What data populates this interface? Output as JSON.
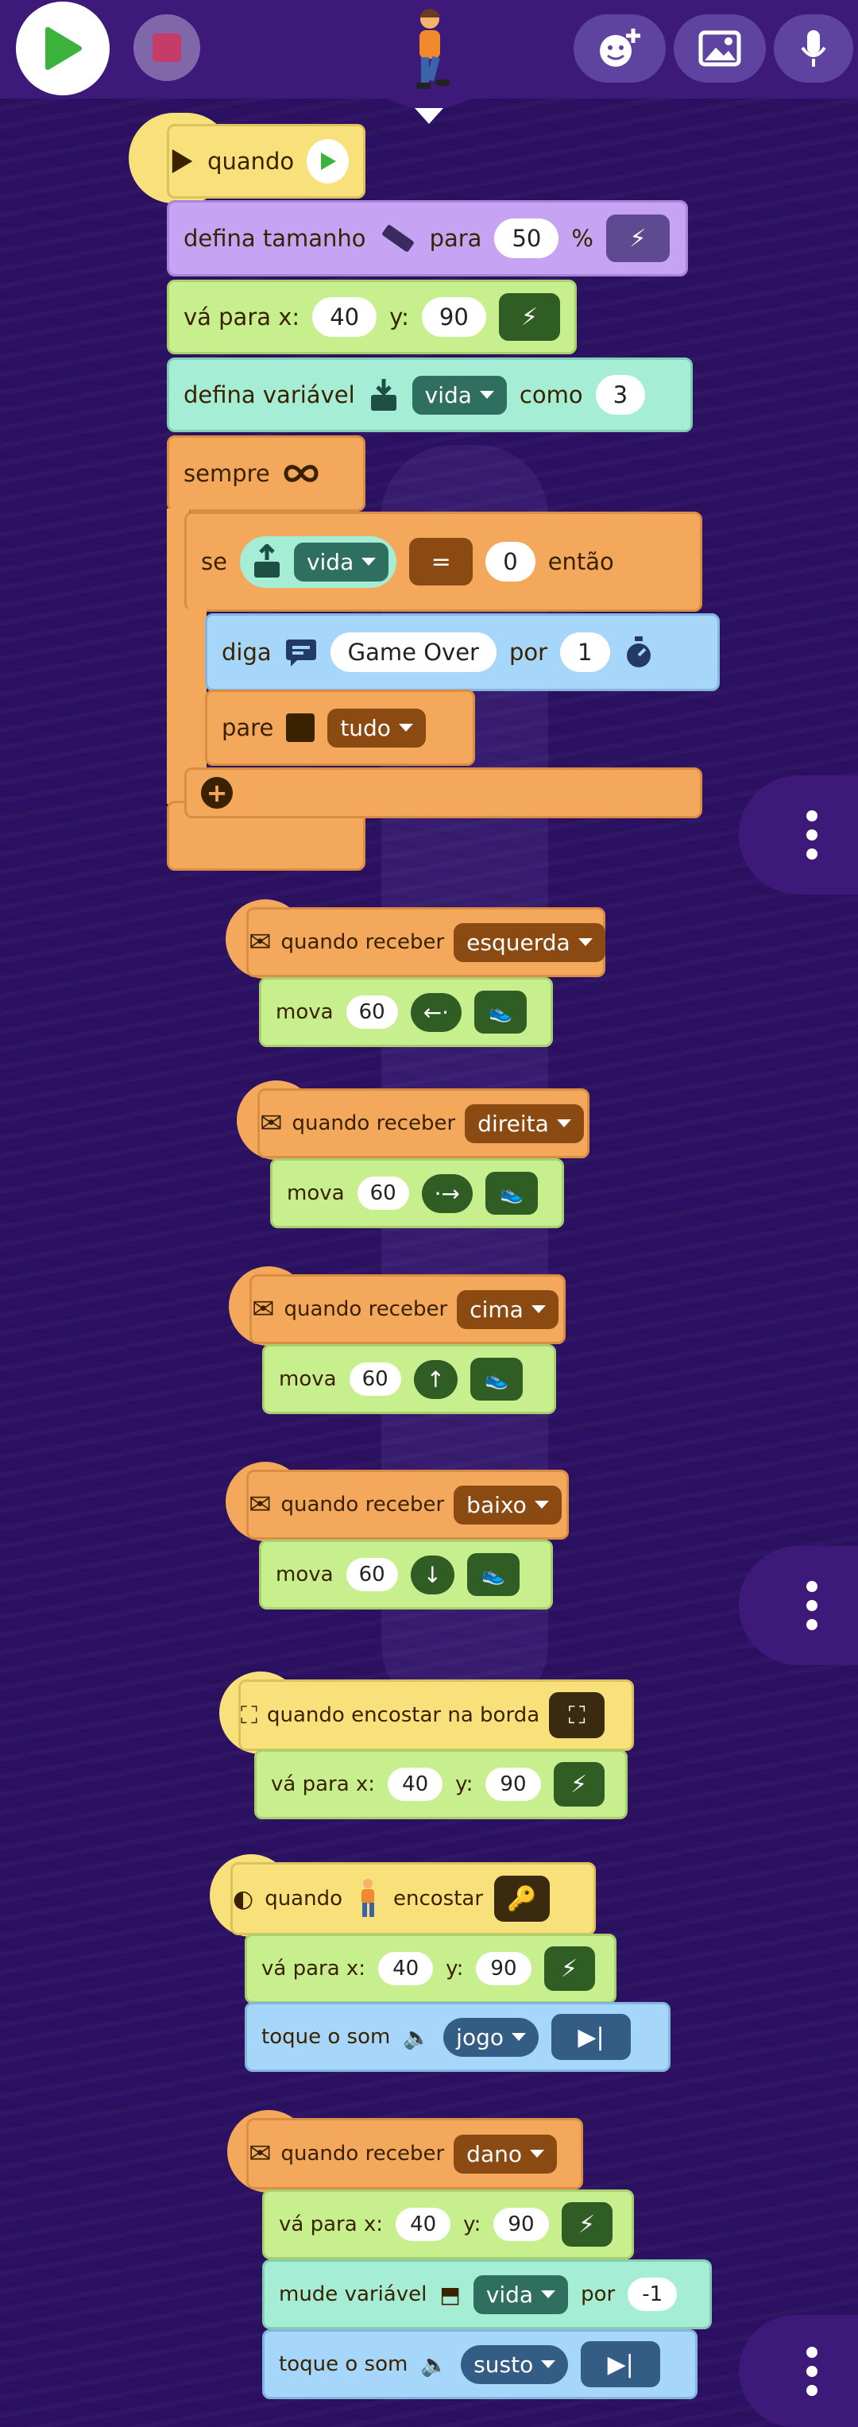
{
  "blocks": {
    "when_flag": {
      "label": "quando"
    },
    "set_size": {
      "label": "defina tamanho",
      "to": "para",
      "value": "50",
      "unit": "%"
    },
    "goto1": {
      "label": "vá para x:",
      "x": "40",
      "ylabel": "y:",
      "y": "90"
    },
    "set_var": {
      "label": "defina variável",
      "var": "vida",
      "as": "como",
      "value": "3"
    },
    "forever": {
      "label": "sempre"
    },
    "if": {
      "label": "se",
      "var": "vida",
      "op": "=",
      "value": "0",
      "then": "então"
    },
    "say": {
      "label": "diga",
      "text": "Game Over",
      "for": "por",
      "secs": "1"
    },
    "stop": {
      "label": "pare",
      "option": "tudo"
    }
  },
  "receive": [
    {
      "label": "quando receber",
      "msg": "esquerda",
      "move": "mova",
      "steps": "60"
    },
    {
      "label": "quando receber",
      "msg": "direita",
      "move": "mova",
      "steps": "60"
    },
    {
      "label": "quando receber",
      "msg": "cima",
      "move": "mova",
      "steps": "60"
    },
    {
      "label": "quando receber",
      "msg": "baixo",
      "move": "mova",
      "steps": "60"
    }
  ],
  "edge": {
    "label": "quando encostar na borda",
    "goto": "vá para x:",
    "x": "40",
    "ylabel": "y:",
    "y": "90"
  },
  "touch": {
    "when": "quando",
    "touch": "encostar",
    "goto": "vá para x:",
    "x": "40",
    "ylabel": "y:",
    "y": "90",
    "sound": "toque o som",
    "sound_name": "jogo"
  },
  "damage": {
    "label": "quando receber",
    "msg": "dano",
    "goto": "vá para x:",
    "x": "40",
    "ylabel": "y:",
    "y": "90",
    "change": "mude variável",
    "var": "vida",
    "by": "por",
    "delta": "-1",
    "sound": "toque o som",
    "sound_name": "susto"
  },
  "colors": {
    "background": "#2c1163",
    "yellow": "#f8e07a",
    "purple": "#c7a4f3",
    "green": "#c8ef8e",
    "teal": "#a5eed5",
    "orange": "#f3a85c",
    "blue": "#a6d6fa"
  }
}
